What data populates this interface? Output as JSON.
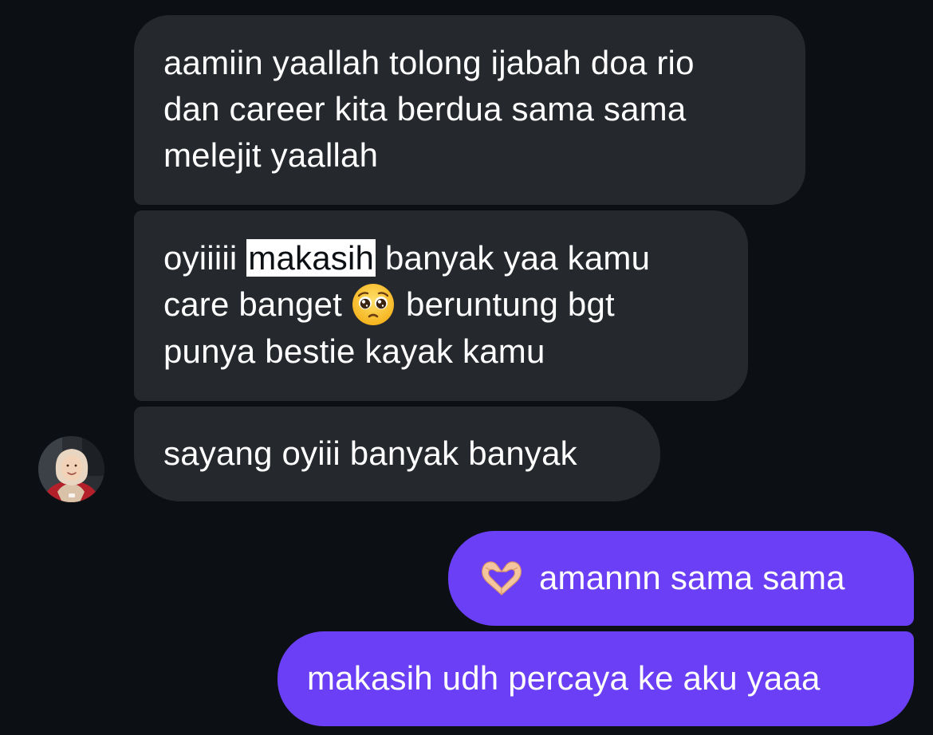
{
  "messages": [
    {
      "id": "msg1",
      "direction": "received",
      "lines": [
        "aamiin yaallah tolong ijabah doa rio",
        "dan career kita berdua sama sama",
        "melejit yaallah"
      ]
    },
    {
      "id": "msg2",
      "direction": "received",
      "line1_before": "oyiiiii ",
      "line1_highlight": "makasih",
      "line1_after": " banyak yaa kamu",
      "line2_before": "care banget",
      "line2_emoji": "pleading-face-emoji",
      "line2_after": "beruntung bgt",
      "line3": "punya bestie kayak kamu"
    },
    {
      "id": "msg3",
      "direction": "received",
      "text": "sayang oyiii banyak banyak"
    },
    {
      "id": "msg4",
      "direction": "sent",
      "emoji": "heart-hands-emoji",
      "text": "amannn sama sama"
    },
    {
      "id": "msg5",
      "direction": "sent",
      "text": "makasih udh percaya ke aku yaaa"
    }
  ],
  "avatar": {
    "icon": "contact-avatar-photo"
  },
  "colors": {
    "background": "#0c1014",
    "received_bubble": "#25292e",
    "sent_bubble": "#6b3ff6",
    "text": "#ffffff",
    "highlight": "#ffffff"
  }
}
